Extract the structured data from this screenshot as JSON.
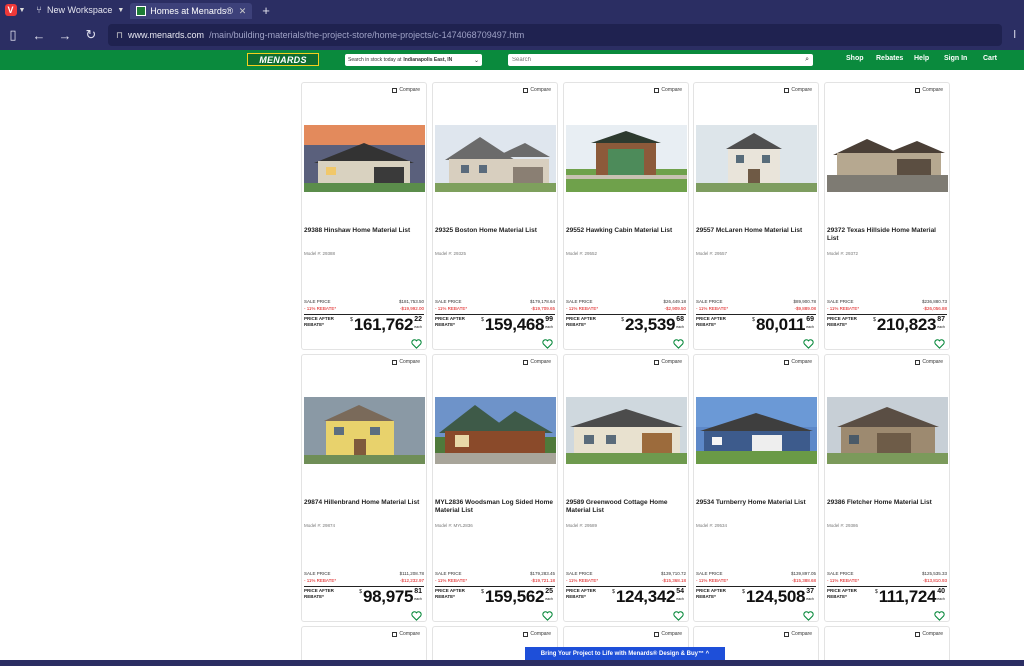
{
  "browser": {
    "workspace_label": "New Workspace",
    "tab_title": "Homes at Menards®",
    "url_host": "www.menards.com",
    "url_path": "/main/building-materials/the-project-store/home-projects/c-1474068709497.htm"
  },
  "header": {
    "logo_text": "MENARDS",
    "store_label": "Search in stock today at",
    "store_name": "Indianapolis East, IN",
    "search_placeholder": "Search",
    "nav": [
      "Shop",
      "Rebates",
      "Help",
      "Sign In",
      "Cart"
    ]
  },
  "common": {
    "compare_label": "Compare",
    "sale_price_label": "SALE PRICE",
    "rebate_label": "- 11% REBATE*",
    "after_rebate_label": "PRICE AFTER REBATE*",
    "each_label": "each"
  },
  "products": [
    {
      "title": "29388   Hinshaw Home Material List",
      "model": "Model #: 29388",
      "sale": "$181,753.50",
      "rebate": "-$19,992.00",
      "price": "161,762",
      "cents": "22",
      "img": "h1"
    },
    {
      "title": "29325   Boston Home Material List",
      "model": "Model #: 29325",
      "sale": "$179,178.64",
      "rebate": "-$19,709.65",
      "price": "159,468",
      "cents": "99",
      "img": "h2"
    },
    {
      "title": "29552   Hawking Cabin Material List",
      "model": "Model #: 29552",
      "sale": "$26,449.18",
      "rebate": "-$2,909.50",
      "price": "23,539",
      "cents": "68",
      "img": "h3"
    },
    {
      "title": "29557   McLaren Home Material List",
      "model": "Model #: 29557",
      "sale": "$89,900.78",
      "rebate": "-$9,889.08",
      "price": "80,011",
      "cents": "69",
      "img": "h4"
    },
    {
      "title": "29372   Texas Hillside Home Material List",
      "model": "Model #: 29372",
      "sale": "$236,880.73",
      "rebate": "-$26,056.88",
      "price": "210,823",
      "cents": "87",
      "img": "h5"
    },
    {
      "title": "29874   Hillenbrand Home Material List",
      "model": "Model #: 29874",
      "sale": "$111,208.78",
      "rebate": "-$12,232.97",
      "price": "98,975",
      "cents": "81",
      "img": "h6"
    },
    {
      "title": "MYL2836   Woodsman Log Sided Home Material List",
      "model": "Model #: MYL2836",
      "sale": "$179,283.45",
      "rebate": "-$19,721.18",
      "price": "159,562",
      "cents": "25",
      "img": "h7"
    },
    {
      "title": "29589   Greenwood Cottage Home Material List",
      "model": "Model #: 29589",
      "sale": "$139,710.72",
      "rebate": "-$15,368.18",
      "price": "124,342",
      "cents": "54",
      "img": "h8"
    },
    {
      "title": "29534   Turnberry Home Material List",
      "model": "Model #: 29534",
      "sale": "$139,897.05",
      "rebate": "-$15,388.68",
      "price": "124,508",
      "cents": "37",
      "img": "h9"
    },
    {
      "title": "29386   Fletcher Home Material List",
      "model": "Model #: 29386",
      "sale": "$125,535.33",
      "rebate": "-$13,810.93",
      "price": "111,724",
      "cents": "40",
      "img": "h10"
    }
  ],
  "banner_text": "Bring Your Project to Life with Menards® Design & Buy™ ^",
  "colors": {
    "menards_green": "#0a8a3d",
    "browser_chrome": "#2b2e63",
    "rebate_red": "#dd1111",
    "banner_blue": "#1e4fd9"
  }
}
